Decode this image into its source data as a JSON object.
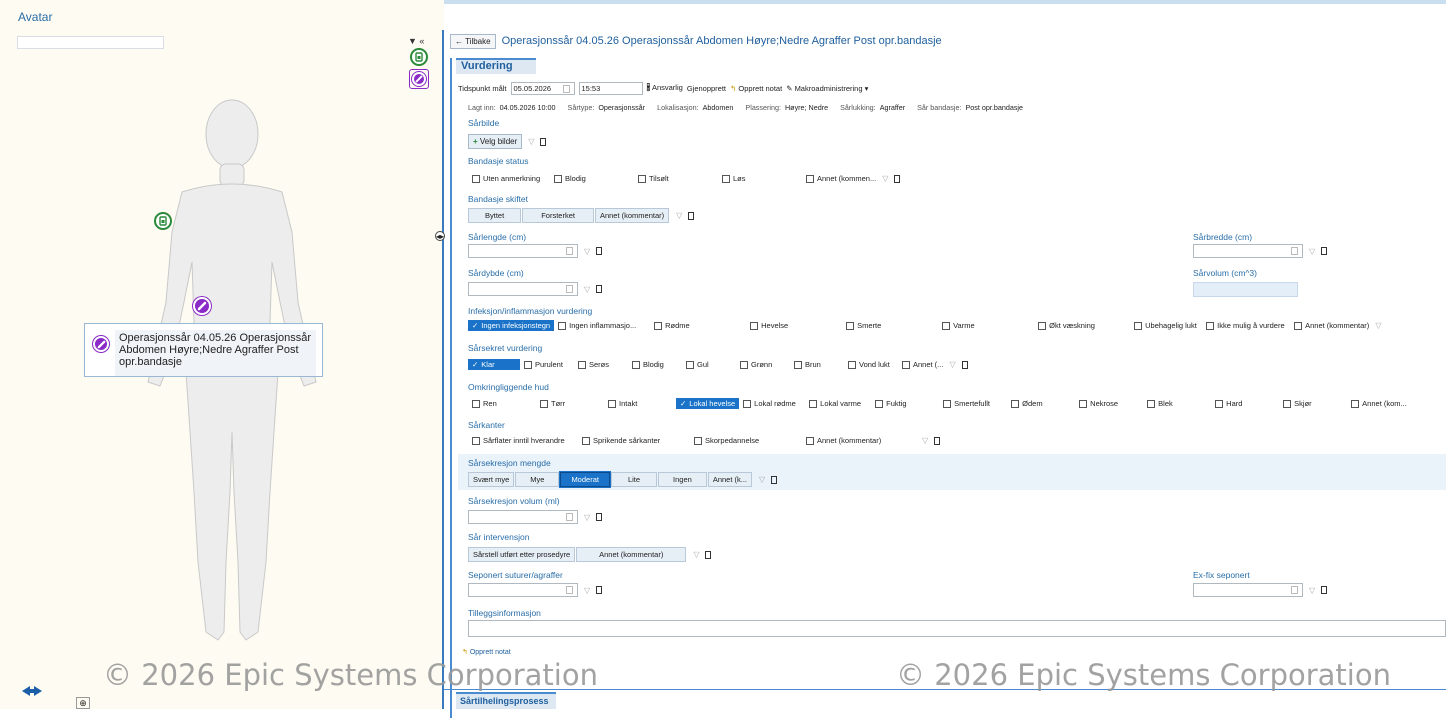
{
  "left": {
    "title": "Avatar",
    "tooltip": "Operasjonssår 04.05.26 Operasjonssår Abdomen Høyre;Nedre Agraffer Post opr.bandasje",
    "bottom_label": "Minimer bilde"
  },
  "header": {
    "back_label": "Tilbake",
    "title": "Operasjonssår 04.05.26 Operasjonssår Abdomen Høyre;Nedre Agraffer Post opr.bandasje"
  },
  "section_title": "Vurdering",
  "measure": {
    "label": "Tidspunkt målt",
    "date": "05.05.2026",
    "time": "15:53",
    "ansvarlig": "Ansvarlig",
    "gjenopprett": "Gjenopprett",
    "opprett_notat": "Opprett notat",
    "makro": "Makroadministrering"
  },
  "info": {
    "lagt_inn_label": "Lagt inn:",
    "lagt_inn": "04.05.2026 10:00",
    "sartype_label": "Sårtype:",
    "sartype": "Operasjonssår",
    "lokalisasjon_label": "Lokalisasjon:",
    "lokalisasjon": "Abdomen",
    "plassering_label": "Plassering:",
    "plassering": "Høyre; Nedre",
    "sarlukking_label": "Sårlukking:",
    "sarlukking": "Agraffer",
    "sarbandasje_label": "Sår bandasje:",
    "sarbandasje": "Post opr.bandasje"
  },
  "sarbilde": {
    "label": "Sårbilde",
    "button": "Velg bilder"
  },
  "bandasje_status": {
    "label": "Bandasje status",
    "options": [
      "Uten anmerkning",
      "Blodig",
      "Tilsølt",
      "Løs",
      "Annet (kommen..."
    ]
  },
  "bandasje_skiftet": {
    "label": "Bandasje skiftet",
    "options": [
      "Byttet",
      "Forsterket",
      "Annet (kommentar)"
    ]
  },
  "sarlengde": {
    "label": "Sårlengde (cm)"
  },
  "sarbredde": {
    "label": "Sårbredde (cm)"
  },
  "sardybde": {
    "label": "Sårdybde (cm)"
  },
  "sarvolum": {
    "label": "Sårvolum (cm^3)"
  },
  "infeksjon": {
    "label": "Infeksjon/inflammasjon vurdering",
    "options": [
      "Ingen infeksjonstegn",
      "Ingen inflammasjo...",
      "Rødme",
      "Hevelse",
      "Smerte",
      "Varme",
      "Økt væskning",
      "Ubehagelig lukt",
      "Ikke mulig å vurdere",
      "Annet (kommentar)"
    ]
  },
  "sarsekret": {
    "label": "Sårsekret vurdering",
    "options": [
      "Klar",
      "Purulent",
      "Serøs",
      "Blodig",
      "Gul",
      "Grønn",
      "Brun",
      "Vond lukt",
      "Annet (..."
    ]
  },
  "omkring": {
    "label": "Omkringliggende hud",
    "options": [
      "Ren",
      "Tørr",
      "Intakt",
      "Lokal hevelse",
      "Lokal rødme",
      "Lokal varme",
      "Fuktig",
      "Smertefullt",
      "Ødem",
      "Nekrose",
      "Blek",
      "Hard",
      "Skjør",
      "Annet (kom..."
    ]
  },
  "sarkanter": {
    "label": "Sårkanter",
    "options": [
      "Sårflater inntil hverandre",
      "Sprikende sårkanter",
      "Skorpedannelse",
      "Annet (kommentar)"
    ]
  },
  "sekresjon_mengde": {
    "label": "Sårsekresjon mengde",
    "options": [
      "Svært mye",
      "Mye",
      "Moderat",
      "Lite",
      "Ingen",
      "Annet (k..."
    ]
  },
  "sekresjon_volum": {
    "label": "Sårsekresjon volum (ml)"
  },
  "intervensjon": {
    "label": "Sår intervensjon",
    "options": [
      "Sårstell utført etter prosedyre",
      "Annet (kommentar)"
    ]
  },
  "seponert": {
    "label": "Seponert suturer/agraffer"
  },
  "exfix": {
    "label": "Ex-fix seponert"
  },
  "tillegg": {
    "label": "Tilleggsinformasjon"
  },
  "bottom_notat": "Opprett notat",
  "footer_tab": "Sårtilhelingsprosess",
  "watermark": "© 2026 Epic Systems Corporation"
}
